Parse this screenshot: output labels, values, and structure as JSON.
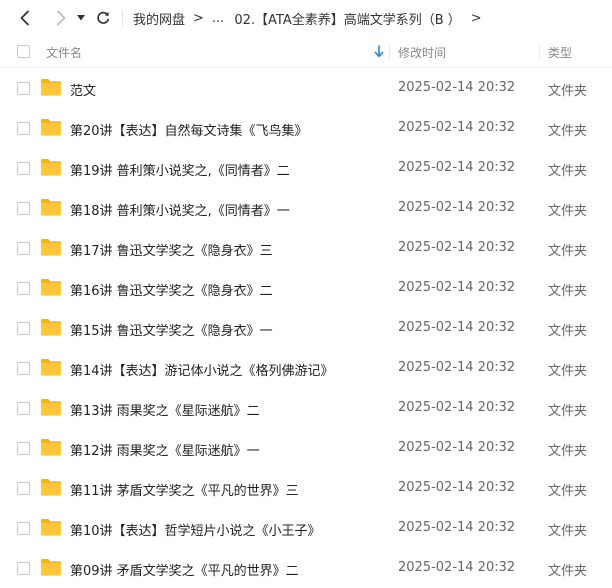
{
  "toolbar": {
    "back_icon": "chevron-left-icon",
    "forward_icon": "chevron-right-icon",
    "dropdown_icon": "caret-down-icon",
    "refresh_icon": "refresh-icon"
  },
  "breadcrumb": {
    "items": [
      "我的网盘",
      "...",
      "02.【ATA全素养】高端文学系列（B ）"
    ],
    "separator": ">"
  },
  "columns": {
    "name": "文件名",
    "modified": "修改时间",
    "type": "类型",
    "sort_icon": "sort-down-arrow-icon"
  },
  "colors": {
    "accent": "#1e88e5",
    "folder": "#ffc53d"
  },
  "files": [
    {
      "name": "范文",
      "modified": "2025-02-14 20:32",
      "type": "文件夹"
    },
    {
      "name": "第20讲【表达】自然每文诗集《飞鸟集》",
      "modified": "2025-02-14 20:32",
      "type": "文件夹"
    },
    {
      "name": "第19讲 普利策小说奖之,《同情者》二",
      "modified": "2025-02-14 20:32",
      "type": "文件夹"
    },
    {
      "name": "第18讲 普利策小说奖之,《同情者》一",
      "modified": "2025-02-14 20:32",
      "type": "文件夹"
    },
    {
      "name": "第17讲 鲁迅文学奖之《隐身衣》三",
      "modified": "2025-02-14 20:32",
      "type": "文件夹"
    },
    {
      "name": "第16讲 鲁迅文学奖之《隐身衣》二",
      "modified": "2025-02-14 20:32",
      "type": "文件夹"
    },
    {
      "name": "第15讲 鲁迅文学奖之《隐身衣》一",
      "modified": "2025-02-14 20:32",
      "type": "文件夹"
    },
    {
      "name": "第14讲【表达】游记体小说之《格列佛游记》",
      "modified": "2025-02-14 20:32",
      "type": "文件夹"
    },
    {
      "name": "第13讲 雨果奖之《星际迷航》二",
      "modified": "2025-02-14 20:32",
      "type": "文件夹"
    },
    {
      "name": "第12讲 雨果奖之《星际迷航》一",
      "modified": "2025-02-14 20:32",
      "type": "文件夹"
    },
    {
      "name": "第11讲 茅盾文学奖之《平凡的世界》三",
      "modified": "2025-02-14 20:32",
      "type": "文件夹"
    },
    {
      "name": "第10讲【表达】哲学短片小说之《小王子》",
      "modified": "2025-02-14 20:32",
      "type": "文件夹"
    },
    {
      "name": "第09讲 矛盾文学奖之《平凡的世界》二",
      "modified": "2025-02-14 20:32",
      "type": "文件夹"
    }
  ]
}
